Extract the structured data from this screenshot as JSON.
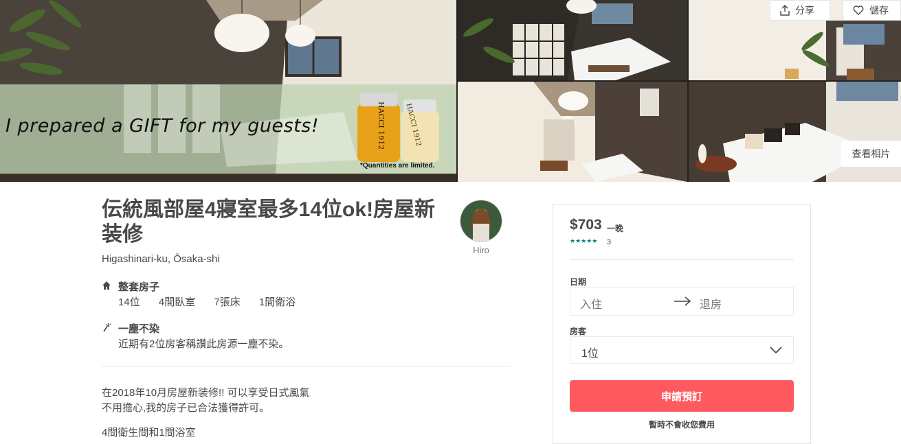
{
  "gallery": {
    "gift_text": "I prepared a GIFT for my guests!",
    "gift_note": "*Quantities are limited.",
    "jar_label_1": "HACCI 1912",
    "jar_label_2": "HACCI 1912",
    "share_label": "分享",
    "save_label": "儲存",
    "view_photos_label": "查看相片"
  },
  "listing": {
    "title": "伝統風部屋4寢室最多14位ok!房屋新装修",
    "location": "Higashinari-ku, Ōsaka-shi",
    "host_name": "Hiro",
    "home_type": {
      "heading": "整套房子",
      "details": [
        "14位",
        "4間臥室",
        "7張床",
        "1間衛浴"
      ]
    },
    "clean": {
      "heading": "一塵不染",
      "detail": "近期有2位房客稱讚此房源一塵不染。"
    },
    "description": [
      "在2018年10月房屋新装修!! 可以享受日式風氣",
      "不用擔心,我的房子已合法獲得許可。",
      "4間衛生間和1間浴室"
    ]
  },
  "booking": {
    "price": "$703",
    "per_night": "一晚",
    "rating": 4.5,
    "stars": "★★★★★",
    "review_count": "3",
    "dates_label": "日期",
    "check_in_placeholder": "入住",
    "check_out_placeholder": "退房",
    "guests_label": "房客",
    "guests_value": "1位",
    "reserve_label": "申請預訂",
    "no_charge_note": "暫時不會收您費用"
  },
  "colors": {
    "brand": "#ff5a5f",
    "star": "#008489",
    "text": "#484848"
  }
}
